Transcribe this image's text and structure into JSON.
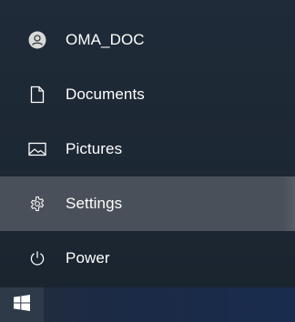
{
  "start_menu": {
    "items": [
      {
        "label": "OMA_DOC",
        "icon": "user-avatar-icon"
      },
      {
        "label": "Documents",
        "icon": "document-icon"
      },
      {
        "label": "Pictures",
        "icon": "pictures-icon"
      },
      {
        "label": "Settings",
        "icon": "gear-icon",
        "highlighted": true
      },
      {
        "label": "Power",
        "icon": "power-icon"
      }
    ]
  },
  "taskbar": {
    "start_icon": "windows-logo-icon"
  },
  "colors": {
    "menu_background": "#1f2b38",
    "highlight": "#4a5059",
    "text": "#ffffff",
    "taskbar": "#1b2a45"
  }
}
